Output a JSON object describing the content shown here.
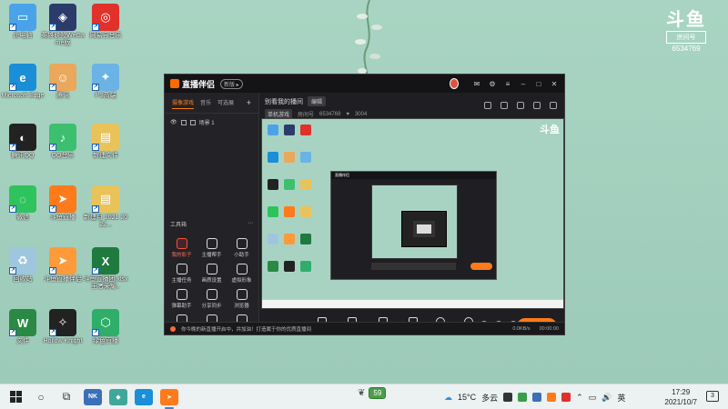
{
  "desktop": {
    "icons": [
      {
        "label": "此电脑",
        "color": "#4aa3e8",
        "glyph": "▭"
      },
      {
        "label": "英雄联盟WeGame版",
        "color": "#2b3b6a",
        "glyph": "◈"
      },
      {
        "label": "网易云音乐",
        "color": "#e0312b",
        "glyph": "◎"
      },
      {
        "label": "Microsoft Edge",
        "color": "#1a8ed6",
        "glyph": "e"
      },
      {
        "label": "腾讯",
        "color": "#e9a85c",
        "glyph": "☺"
      },
      {
        "label": "PS高端",
        "color": "#6ab3e4",
        "glyph": "✦"
      },
      {
        "label": "腾讯QQ",
        "color": "#222222",
        "glyph": "◐"
      },
      {
        "label": "QQ音乐",
        "color": "#3cc070",
        "glyph": "♪"
      },
      {
        "label": "新建文件",
        "color": "#e8c35a",
        "glyph": "▤"
      },
      {
        "label": "微信",
        "color": "#2ec35c",
        "glyph": "◌"
      },
      {
        "label": "斗鱼直播",
        "color": "#ff7a1a",
        "glyph": "➤"
      },
      {
        "label": "新建月 2021 2022...",
        "color": "#e8c35a",
        "glyph": "▤"
      },
      {
        "label": "回收站",
        "color": "#9fc6df",
        "glyph": "♻"
      },
      {
        "label": "斗鱼直播伴侣",
        "color": "#ff9a3a",
        "glyph": "➤"
      },
      {
        "label": "斗鱼直播团.xlsx 王者荣耀..",
        "color": "#1f7a3f",
        "glyph": "X"
      },
      {
        "label": "文件",
        "color": "#2a8a44",
        "glyph": "W"
      },
      {
        "label": "Hollow Knight",
        "color": "#222222",
        "glyph": "✧"
      },
      {
        "label": "绿色直播",
        "color": "#2fae6a",
        "glyph": "⬡"
      }
    ]
  },
  "room_badge": {
    "logo": "斗鱼",
    "tag": "房间号",
    "number": "6534769"
  },
  "app": {
    "title": "直播伴侣",
    "version": "新版 ▸",
    "tabs": [
      "摄像游戏",
      "音乐",
      "可选展"
    ],
    "scene_label": "场景 1",
    "tools_label": "工具箱",
    "tools": [
      {
        "label": "我的影子"
      },
      {
        "label": "主播帮手"
      },
      {
        "label": "小助手"
      },
      {
        "label": "主播任务"
      },
      {
        "label": "画质设置"
      },
      {
        "label": "虚拟形象"
      },
      {
        "label": "弹幕助手"
      },
      {
        "label": "分享同步"
      },
      {
        "label": "浏览器"
      },
      {
        "label": "更多"
      },
      {
        "label": "直播间"
      },
      {
        "label": "开播"
      }
    ],
    "room_title": "别看我的播间",
    "edit_label": "编辑",
    "category": "单机游戏",
    "room_no_label": "房间号",
    "room_no": "6534769",
    "followers": "3004",
    "controls": [
      "直播屏幕",
      "摄像头",
      "手机投屏",
      "多媒体",
      "麦克风",
      "扬声器"
    ],
    "start_label": "开始直播",
    "status_text": "你今晚的新直播开启中，并加油！打造属于你的优质直播间",
    "status_right": [
      "0.0KB/s",
      "00:00:00"
    ],
    "preview_logo": "斗鱼"
  },
  "taskbar": {
    "apps": [
      {
        "label": "NK",
        "color": "#3b6fb8"
      },
      {
        "label": "◆",
        "color": "#3fa89a"
      },
      {
        "label": "e",
        "color": "#1a8ed6"
      },
      {
        "label": "➤",
        "color": "#ff7a1a"
      }
    ],
    "tray_pill": "59",
    "weather_temp": "15°C",
    "weather_text": "多云",
    "ime": "英",
    "time": "17:29",
    "date": "2021/10/7"
  }
}
